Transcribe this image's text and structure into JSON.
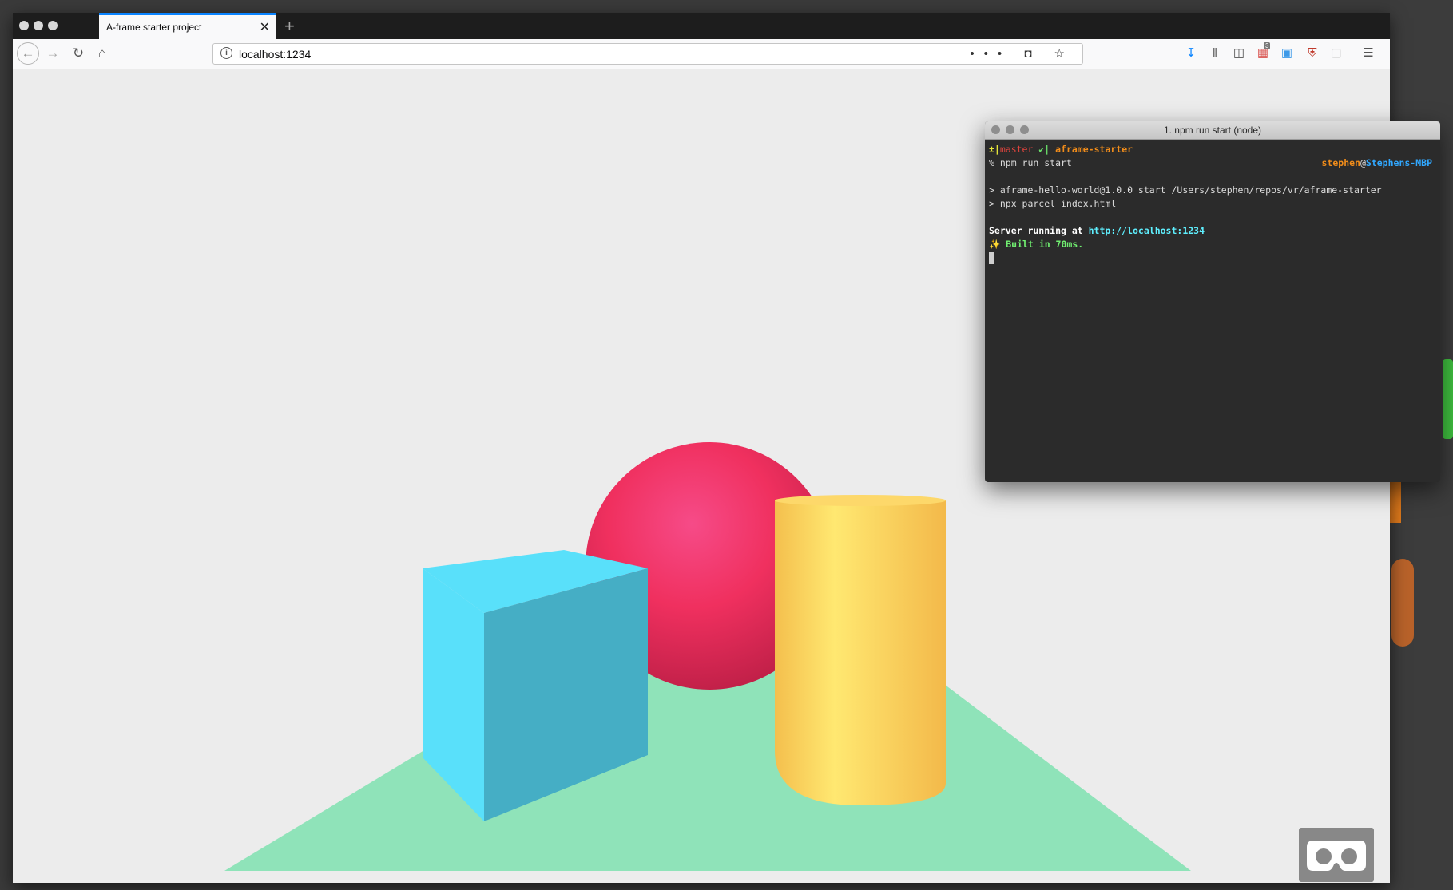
{
  "browser": {
    "tab_title": "A-frame starter project",
    "tab_close": "✕",
    "new_tab": "+",
    "url": "localhost:1234",
    "url_actions": "••• ◘ ☆"
  },
  "toolbar_badge": "3",
  "terminal": {
    "title": "1. npm run start (node)",
    "line1": {
      "plus": "±|",
      "branch": "master",
      "check": " ✔|",
      "dir": " aframe-starter"
    },
    "line2_prompt": "% npm run start",
    "rprompt_user": "stephen",
    "rprompt_at": "@",
    "rprompt_host": "Stephens-MBP",
    "line3": "> aframe-hello-world@1.0.0 start /Users/stephen/repos/vr/aframe-starter",
    "line4": "> npx parcel index.html",
    "line5_label": "Server running at ",
    "line5_url": "http://localhost:1234",
    "line6": "✨ Built in 70ms."
  },
  "colors": {
    "sphere": "#ef2d5e",
    "box": "#4cc3d9",
    "cylinder": "#ffc65d",
    "plane": "#7bc8a4",
    "sky": "#ececec"
  }
}
